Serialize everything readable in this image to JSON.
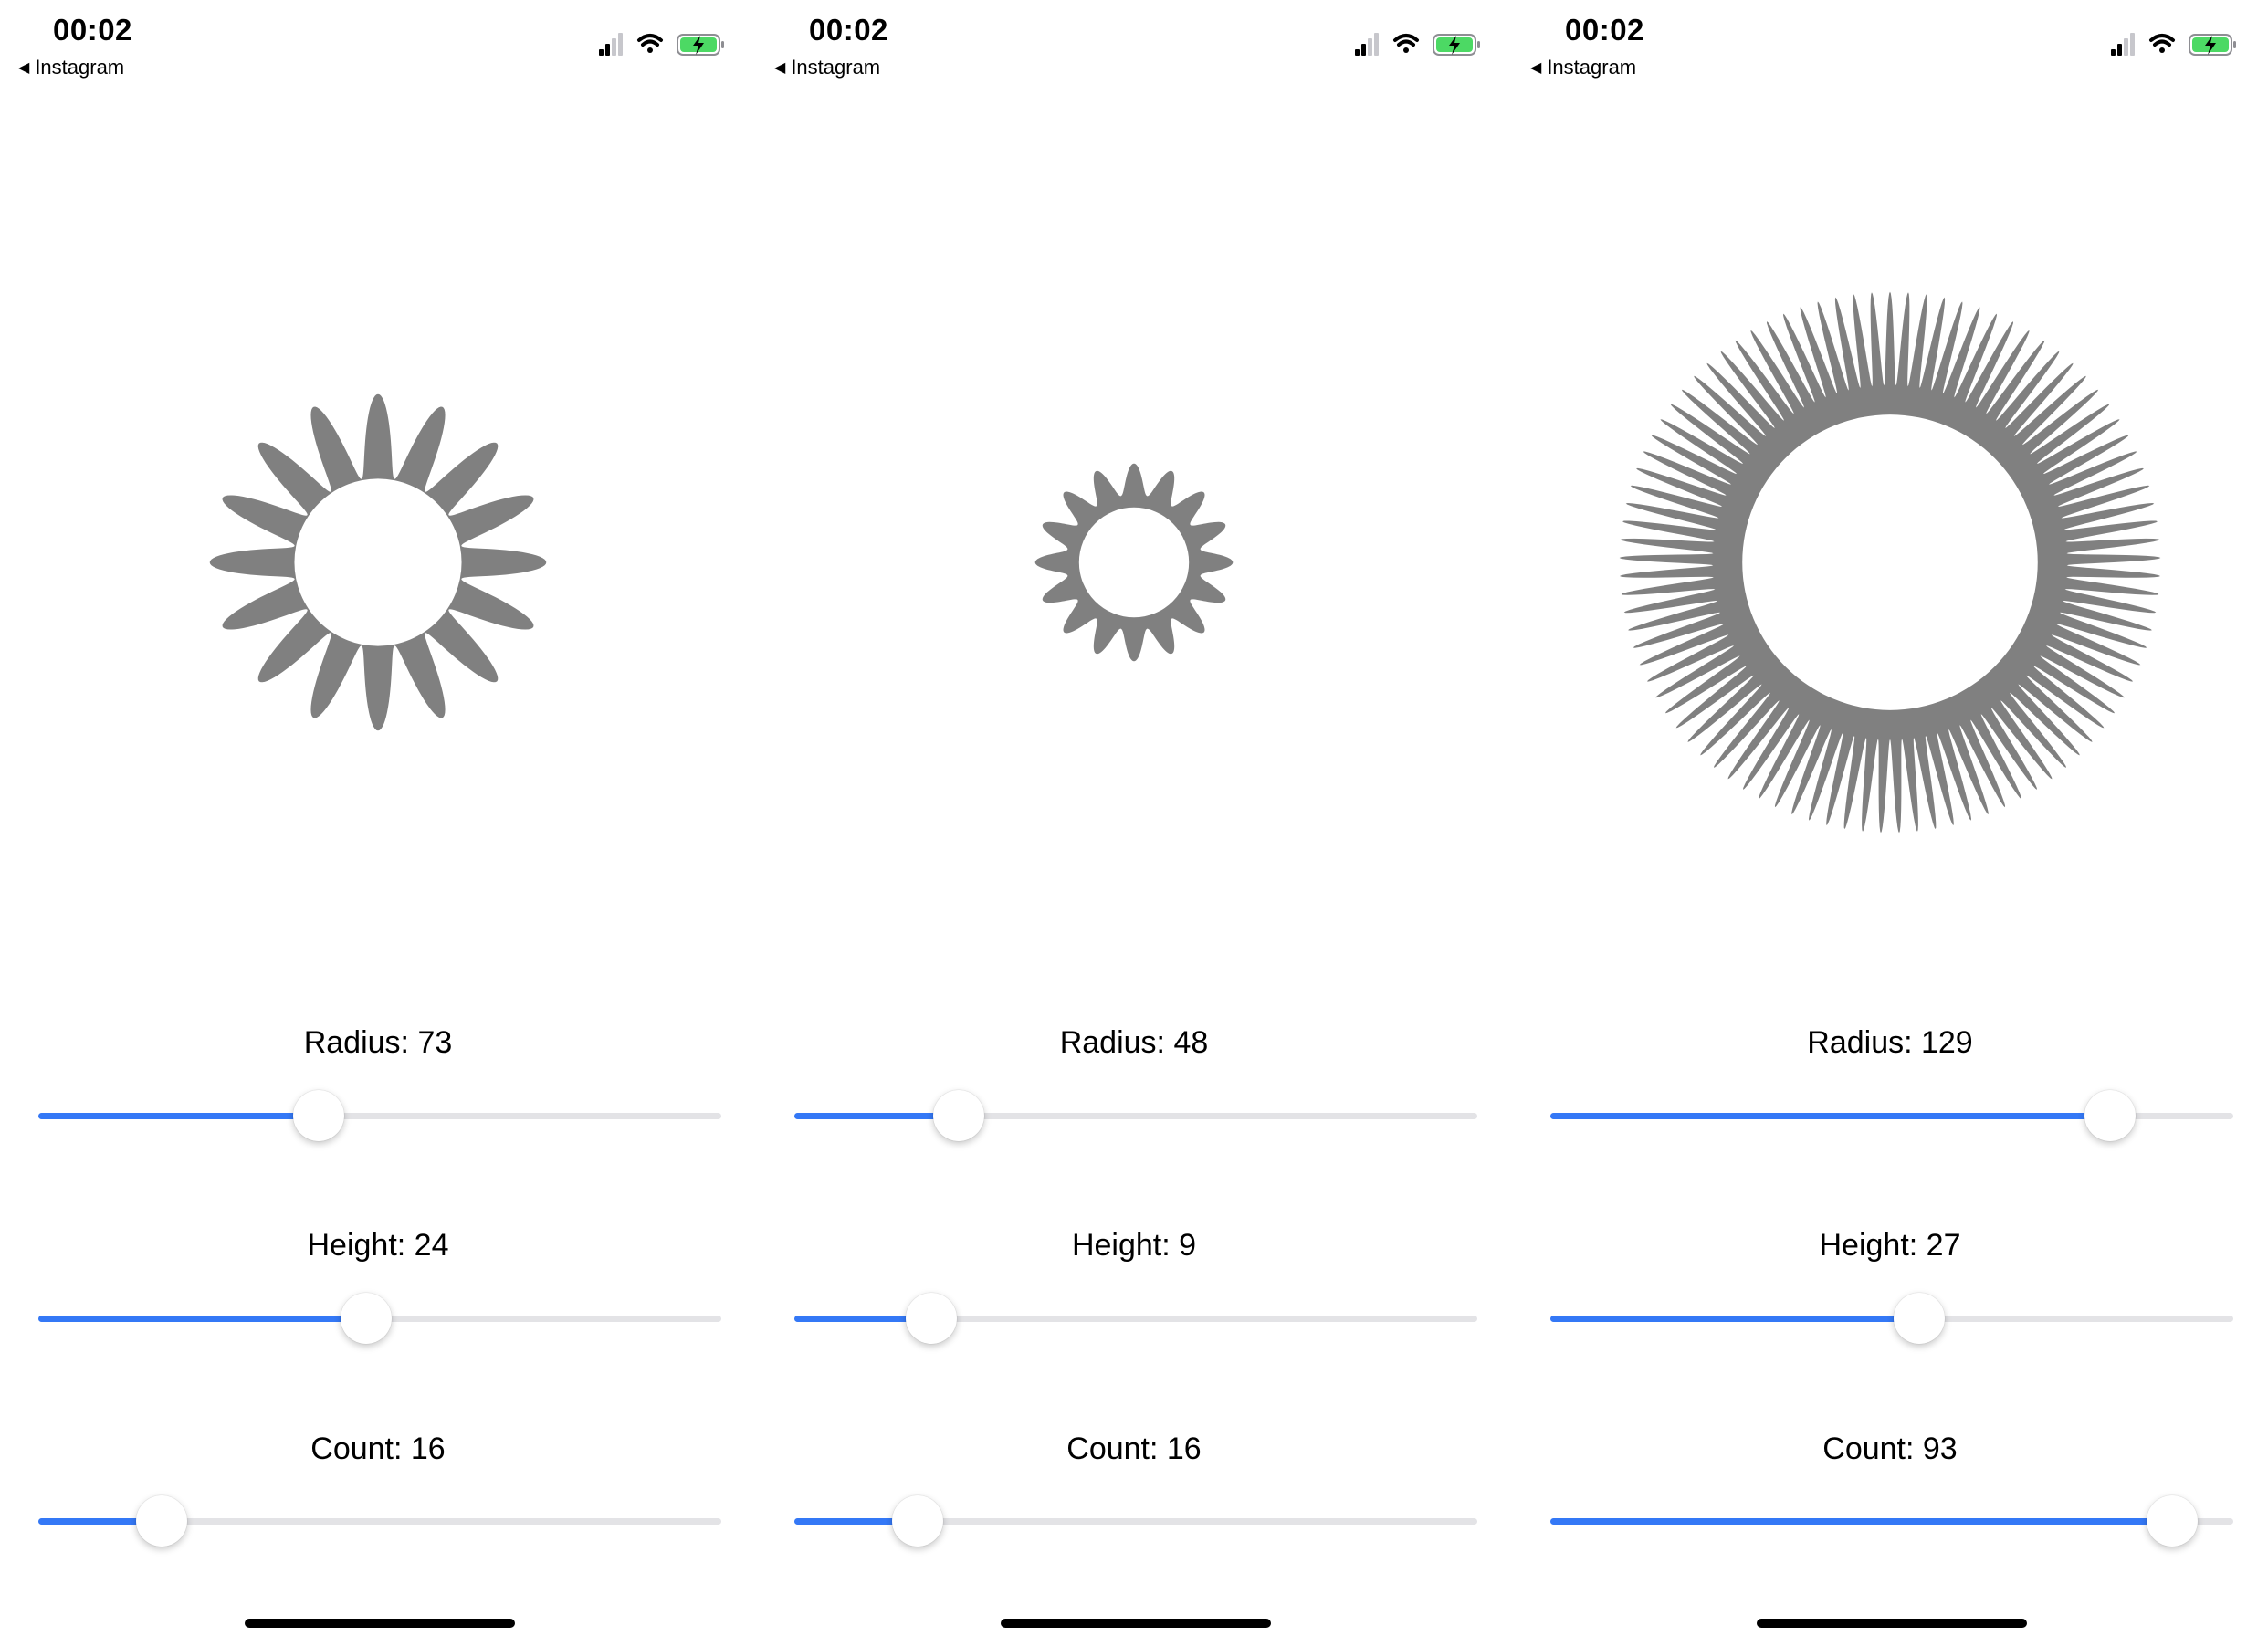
{
  "screens": [
    {
      "status_time": "00:02",
      "back_app": "Instagram",
      "radius_label": "Radius: 73",
      "height_label": "Height: 24",
      "count_label": "Count: 16",
      "gear": {
        "radius": 73,
        "height": 24,
        "count": 16
      },
      "sliders": {
        "radius_fraction": 0.41,
        "height_fraction": 0.48,
        "count_fraction": 0.18
      }
    },
    {
      "status_time": "00:02",
      "back_app": "Instagram",
      "radius_label": "Radius: 48",
      "height_label": "Height: 9",
      "count_label": "Count: 16",
      "gear": {
        "radius": 48,
        "height": 9,
        "count": 16
      },
      "sliders": {
        "radius_fraction": 0.24,
        "height_fraction": 0.2,
        "count_fraction": 0.18
      }
    },
    {
      "status_time": "00:02",
      "back_app": "Instagram",
      "radius_label": "Radius: 129",
      "height_label": "Height: 27",
      "count_label": "Count: 93",
      "gear": {
        "radius": 129,
        "height": 27,
        "count": 93
      },
      "sliders": {
        "radius_fraction": 0.82,
        "height_fraction": 0.54,
        "count_fraction": 0.91
      }
    }
  ],
  "colors": {
    "gear": "#808080",
    "slider_fill": "#3478f6",
    "slider_track": "#e3e3e6",
    "battery": "#4cd964"
  },
  "icons": {
    "back": "back-triangle-icon",
    "signal": "cellular-signal-icon",
    "wifi": "wifi-icon",
    "battery": "battery-charging-icon"
  }
}
